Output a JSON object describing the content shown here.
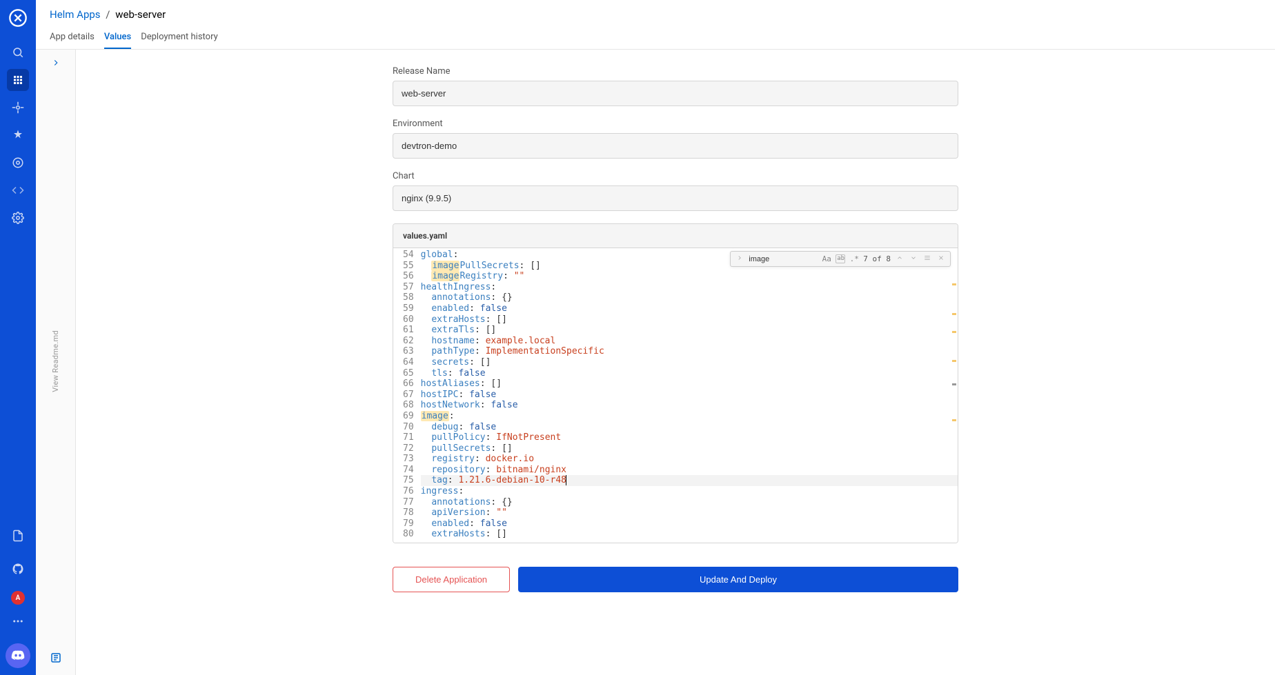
{
  "breadcrumb": {
    "root": "Helm Apps",
    "current": "web-server"
  },
  "tabs": {
    "details": "App details",
    "values": "Values",
    "history": "Deployment history"
  },
  "fields": {
    "release_name_label": "Release Name",
    "release_name_value": "web-server",
    "env_label": "Environment",
    "env_value": "devtron-demo",
    "chart_label": "Chart",
    "chart_value": "nginx (9.9.5)"
  },
  "editor": {
    "filename": "values.yaml",
    "find": {
      "query": "image",
      "count": "7 of 8"
    },
    "lines": [
      {
        "n": 54,
        "tokens": [
          {
            "t": "global",
            "c": "k"
          },
          {
            "t": ":",
            "c": ""
          }
        ]
      },
      {
        "n": 55,
        "tokens": [
          {
            "t": "  ",
            "c": ""
          },
          {
            "t": "image",
            "c": "k",
            "hl": true
          },
          {
            "t": "PullSecrets",
            "c": "k"
          },
          {
            "t": ": ",
            "c": ""
          },
          {
            "t": "[]",
            "c": ""
          }
        ]
      },
      {
        "n": 56,
        "tokens": [
          {
            "t": "  ",
            "c": ""
          },
          {
            "t": "image",
            "c": "k",
            "hl": true
          },
          {
            "t": "Registry",
            "c": "k"
          },
          {
            "t": ": ",
            "c": ""
          },
          {
            "t": "\"\"",
            "c": "s"
          }
        ]
      },
      {
        "n": 57,
        "tokens": [
          {
            "t": "healthIngress",
            "c": "k"
          },
          {
            "t": ":",
            "c": ""
          }
        ]
      },
      {
        "n": 58,
        "tokens": [
          {
            "t": "  ",
            "c": ""
          },
          {
            "t": "annotations",
            "c": "k"
          },
          {
            "t": ": ",
            "c": ""
          },
          {
            "t": "{}",
            "c": ""
          }
        ]
      },
      {
        "n": 59,
        "tokens": [
          {
            "t": "  ",
            "c": ""
          },
          {
            "t": "enabled",
            "c": "k"
          },
          {
            "t": ": ",
            "c": ""
          },
          {
            "t": "false",
            "c": "b"
          }
        ]
      },
      {
        "n": 60,
        "tokens": [
          {
            "t": "  ",
            "c": ""
          },
          {
            "t": "extraHosts",
            "c": "k"
          },
          {
            "t": ": ",
            "c": ""
          },
          {
            "t": "[]",
            "c": ""
          }
        ]
      },
      {
        "n": 61,
        "tokens": [
          {
            "t": "  ",
            "c": ""
          },
          {
            "t": "extraTls",
            "c": "k"
          },
          {
            "t": ": ",
            "c": ""
          },
          {
            "t": "[]",
            "c": ""
          }
        ]
      },
      {
        "n": 62,
        "tokens": [
          {
            "t": "  ",
            "c": ""
          },
          {
            "t": "hostname",
            "c": "k"
          },
          {
            "t": ": ",
            "c": ""
          },
          {
            "t": "example.local",
            "c": "s"
          }
        ]
      },
      {
        "n": 63,
        "tokens": [
          {
            "t": "  ",
            "c": ""
          },
          {
            "t": "pathType",
            "c": "k"
          },
          {
            "t": ": ",
            "c": ""
          },
          {
            "t": "ImplementationSpecific",
            "c": "s"
          }
        ]
      },
      {
        "n": 64,
        "tokens": [
          {
            "t": "  ",
            "c": ""
          },
          {
            "t": "secrets",
            "c": "k"
          },
          {
            "t": ": ",
            "c": ""
          },
          {
            "t": "[]",
            "c": ""
          }
        ]
      },
      {
        "n": 65,
        "tokens": [
          {
            "t": "  ",
            "c": ""
          },
          {
            "t": "tls",
            "c": "k"
          },
          {
            "t": ": ",
            "c": ""
          },
          {
            "t": "false",
            "c": "b"
          }
        ]
      },
      {
        "n": 66,
        "tokens": [
          {
            "t": "hostAliases",
            "c": "k"
          },
          {
            "t": ": ",
            "c": ""
          },
          {
            "t": "[]",
            "c": ""
          }
        ]
      },
      {
        "n": 67,
        "tokens": [
          {
            "t": "hostIPC",
            "c": "k"
          },
          {
            "t": ": ",
            "c": ""
          },
          {
            "t": "false",
            "c": "b"
          }
        ]
      },
      {
        "n": 68,
        "tokens": [
          {
            "t": "hostNetwork",
            "c": "k"
          },
          {
            "t": ": ",
            "c": ""
          },
          {
            "t": "false",
            "c": "b"
          }
        ]
      },
      {
        "n": 69,
        "tokens": [
          {
            "t": "image",
            "c": "k",
            "hl": true
          },
          {
            "t": ":",
            "c": ""
          }
        ]
      },
      {
        "n": 70,
        "tokens": [
          {
            "t": "  ",
            "c": ""
          },
          {
            "t": "debug",
            "c": "k"
          },
          {
            "t": ": ",
            "c": ""
          },
          {
            "t": "false",
            "c": "b"
          }
        ]
      },
      {
        "n": 71,
        "tokens": [
          {
            "t": "  ",
            "c": ""
          },
          {
            "t": "pullPolicy",
            "c": "k"
          },
          {
            "t": ": ",
            "c": ""
          },
          {
            "t": "IfNotPresent",
            "c": "s"
          }
        ]
      },
      {
        "n": 72,
        "tokens": [
          {
            "t": "  ",
            "c": ""
          },
          {
            "t": "pullSecrets",
            "c": "k"
          },
          {
            "t": ": ",
            "c": ""
          },
          {
            "t": "[]",
            "c": ""
          }
        ]
      },
      {
        "n": 73,
        "tokens": [
          {
            "t": "  ",
            "c": ""
          },
          {
            "t": "registry",
            "c": "k"
          },
          {
            "t": ": ",
            "c": ""
          },
          {
            "t": "docker.io",
            "c": "s"
          }
        ]
      },
      {
        "n": 74,
        "tokens": [
          {
            "t": "  ",
            "c": ""
          },
          {
            "t": "repository",
            "c": "k"
          },
          {
            "t": ": ",
            "c": ""
          },
          {
            "t": "bitnami/nginx",
            "c": "s"
          }
        ]
      },
      {
        "n": 75,
        "tokens": [
          {
            "t": "  ",
            "c": ""
          },
          {
            "t": "tag",
            "c": "k"
          },
          {
            "t": ": ",
            "c": ""
          },
          {
            "t": "1.21.6-debian-10-r48",
            "c": "s"
          }
        ],
        "current": true
      },
      {
        "n": 76,
        "tokens": [
          {
            "t": "ingress",
            "c": "k"
          },
          {
            "t": ":",
            "c": ""
          }
        ]
      },
      {
        "n": 77,
        "tokens": [
          {
            "t": "  ",
            "c": ""
          },
          {
            "t": "annotations",
            "c": "k"
          },
          {
            "t": ": ",
            "c": ""
          },
          {
            "t": "{}",
            "c": ""
          }
        ]
      },
      {
        "n": 78,
        "tokens": [
          {
            "t": "  ",
            "c": ""
          },
          {
            "t": "apiVersion",
            "c": "k"
          },
          {
            "t": ": ",
            "c": ""
          },
          {
            "t": "\"\"",
            "c": "s"
          }
        ]
      },
      {
        "n": 79,
        "tokens": [
          {
            "t": "  ",
            "c": ""
          },
          {
            "t": "enabled",
            "c": "k"
          },
          {
            "t": ": ",
            "c": ""
          },
          {
            "t": "false",
            "c": "b"
          }
        ]
      },
      {
        "n": 80,
        "tokens": [
          {
            "t": "  ",
            "c": ""
          },
          {
            "t": "extraHosts",
            "c": "k"
          },
          {
            "t": ": ",
            "c": ""
          },
          {
            "t": "[]",
            "c": ""
          }
        ]
      }
    ]
  },
  "readme": {
    "label": "View Readme.md"
  },
  "buttons": {
    "delete": "Delete Application",
    "deploy": "Update And Deploy"
  },
  "avatar_letter": "A"
}
